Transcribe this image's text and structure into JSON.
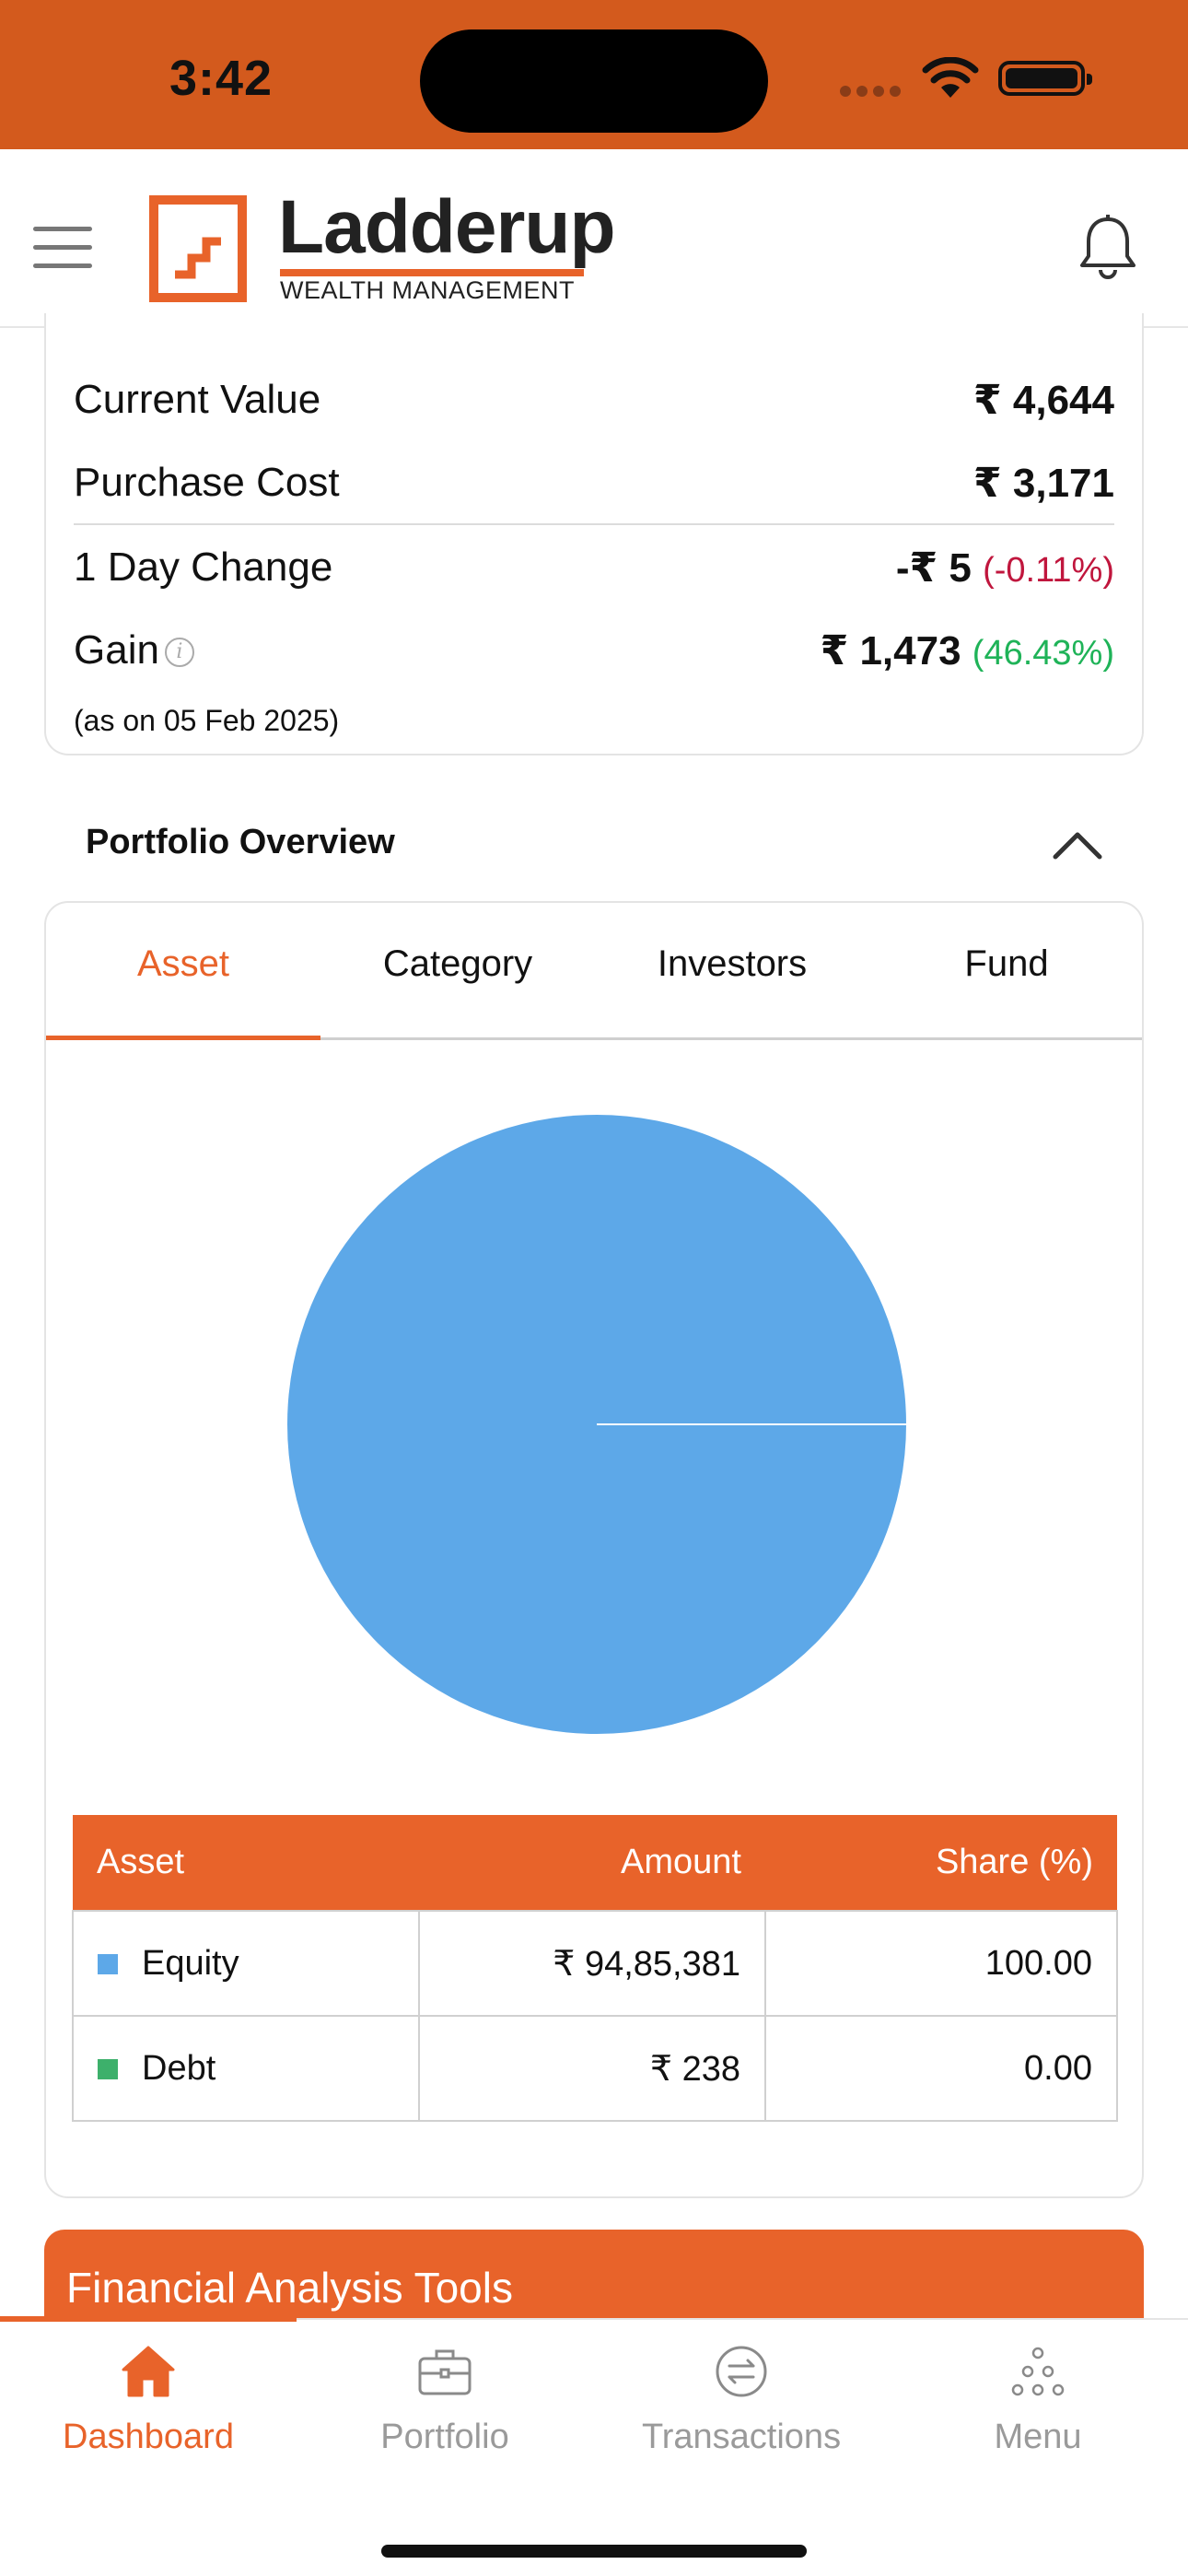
{
  "status_bar": {
    "time": "3:42"
  },
  "brand": {
    "name": "Ladderup",
    "tagline": "WEALTH MANAGEMENT",
    "accent": "#E8632A"
  },
  "header_icons": {
    "menu": "hamburger-icon",
    "notifications": "bell-icon"
  },
  "summary": {
    "current_value": {
      "label": "Current Value",
      "value": "₹ 4,644"
    },
    "purchase_cost": {
      "label": "Purchase Cost",
      "value": "₹ 3,171"
    },
    "day_change": {
      "label": "1 Day Change",
      "value": "-₹ 5",
      "pct": "(-0.11%)"
    },
    "gain": {
      "label": "Gain",
      "value": "₹ 1,473",
      "pct": "(46.43%)"
    },
    "as_on": "(as on 05 Feb 2025)"
  },
  "portfolio_overview": {
    "title": "Portfolio Overview",
    "tabs": [
      "Asset",
      "Category",
      "Investors",
      "Fund"
    ],
    "active_tab": "Asset",
    "table": {
      "headers": [
        "Asset",
        "Amount",
        "Share (%)"
      ],
      "rows": [
        {
          "asset": "Equity",
          "amount": "₹ 94,85,381",
          "share": "100.00",
          "color": "#5DA8E8"
        },
        {
          "asset": "Debt",
          "amount": "₹ 238",
          "share": "0.00",
          "color": "#3DB06B"
        }
      ]
    }
  },
  "chart_data": {
    "type": "pie",
    "categories": [
      "Equity",
      "Debt"
    ],
    "values": [
      100.0,
      0.0
    ],
    "colors": [
      "#5DA8E8",
      "#3DB06B"
    ]
  },
  "financial_tools": {
    "title": "Financial Analysis Tools"
  },
  "bottom_nav": {
    "items": [
      {
        "label": "Dashboard",
        "icon": "home-icon"
      },
      {
        "label": "Portfolio",
        "icon": "briefcase-icon"
      },
      {
        "label": "Transactions",
        "icon": "transfer-icon"
      },
      {
        "label": "Menu",
        "icon": "dots-menu-icon"
      }
    ],
    "active": "Dashboard"
  }
}
